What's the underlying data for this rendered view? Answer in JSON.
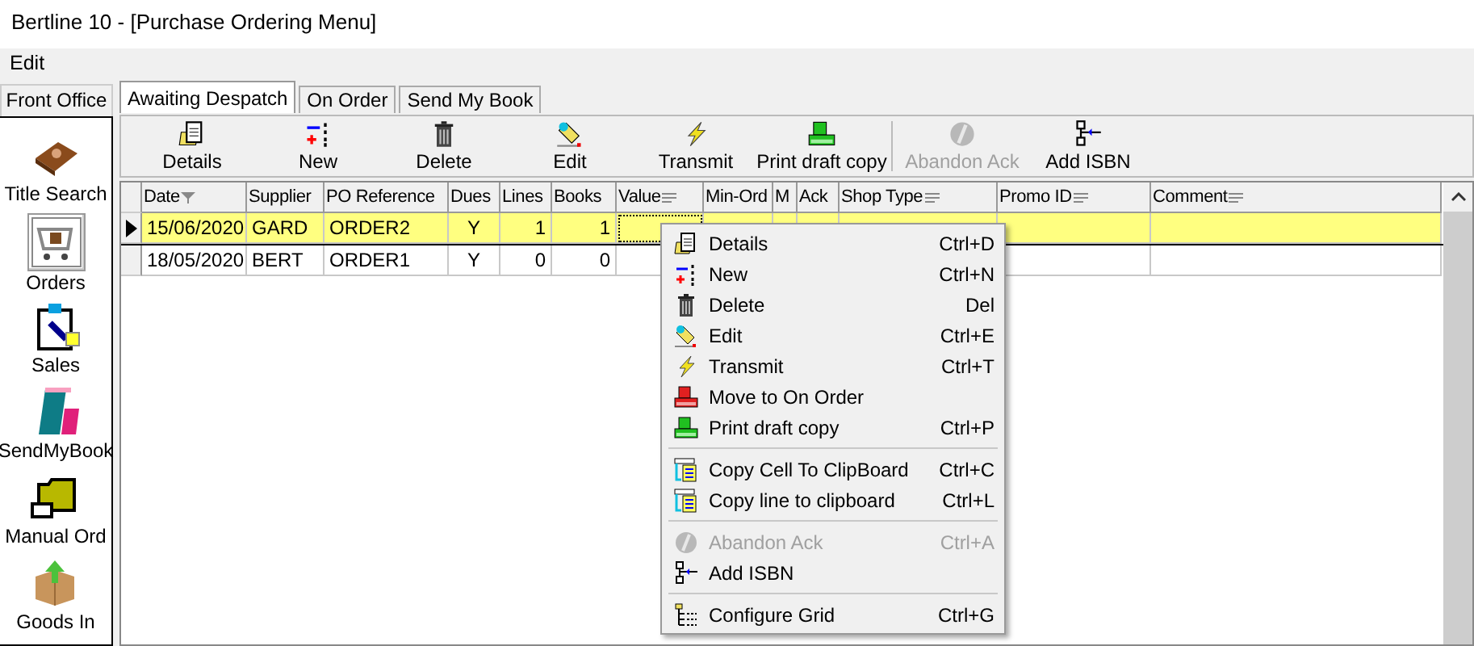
{
  "window": {
    "title": "Bertline 10 - [Purchase Ordering Menu]"
  },
  "menu_bar": [
    "Edit"
  ],
  "sidebar": {
    "tab": "Front Office",
    "items": [
      {
        "label": "Title Search",
        "selected": false
      },
      {
        "label": "Orders",
        "selected": true
      },
      {
        "label": "Sales",
        "selected": false
      },
      {
        "label": "SendMyBook",
        "selected": false
      },
      {
        "label": "Manual Ord",
        "selected": false
      },
      {
        "label": "Goods In",
        "selected": false
      }
    ]
  },
  "tabs": [
    {
      "label": "Awaiting Despatch",
      "selected": true
    },
    {
      "label": "On Order",
      "selected": false
    },
    {
      "label": "Send My Book",
      "selected": false
    }
  ],
  "toolbar": [
    {
      "label": "Details",
      "disabled": false
    },
    {
      "label": "New",
      "disabled": false
    },
    {
      "label": "Delete",
      "disabled": false
    },
    {
      "label": "Edit",
      "disabled": false
    },
    {
      "label": "Transmit",
      "disabled": false
    },
    {
      "label": "Print draft copy",
      "disabled": false
    },
    {
      "label": "Abandon Ack",
      "disabled": true
    },
    {
      "label": "Add ISBN",
      "disabled": false
    }
  ],
  "table": {
    "columns": [
      {
        "label": "Date",
        "sorted": true,
        "filter": false
      },
      {
        "label": "Supplier",
        "sorted": false,
        "filter": false
      },
      {
        "label": "PO Reference",
        "sorted": false,
        "filter": false
      },
      {
        "label": "Dues",
        "sorted": false,
        "filter": false
      },
      {
        "label": "Lines",
        "sorted": false,
        "filter": false
      },
      {
        "label": "Books",
        "sorted": false,
        "filter": false
      },
      {
        "label": "Value",
        "sorted": false,
        "filter": true
      },
      {
        "label": "Min-Ord",
        "sorted": false,
        "filter": false
      },
      {
        "label": "M",
        "sorted": false,
        "filter": false
      },
      {
        "label": "Ack",
        "sorted": false,
        "filter": false
      },
      {
        "label": "Shop Type",
        "sorted": false,
        "filter": true
      },
      {
        "label": "Promo ID",
        "sorted": false,
        "filter": true
      },
      {
        "label": "Comment",
        "sorted": false,
        "filter": true
      }
    ],
    "rows": [
      {
        "selected": true,
        "cells": [
          "15/06/2020",
          "GARD",
          "ORDER2",
          "Y",
          "1",
          "1",
          "",
          "",
          "",
          "",
          "",
          "",
          ""
        ]
      },
      {
        "selected": false,
        "cells": [
          "18/05/2020",
          "BERT",
          "ORDER1",
          "Y",
          "0",
          "0",
          "",
          "",
          "",
          "",
          "",
          "",
          ""
        ]
      }
    ]
  },
  "context_menu": [
    [
      {
        "label": "Details",
        "shortcut": "Ctrl+D",
        "disabled": false
      },
      {
        "label": "New",
        "shortcut": "Ctrl+N",
        "disabled": false
      },
      {
        "label": "Delete",
        "shortcut": "Del",
        "disabled": false
      },
      {
        "label": "Edit",
        "shortcut": "Ctrl+E",
        "disabled": false
      },
      {
        "label": "Transmit",
        "shortcut": "Ctrl+T",
        "disabled": false
      },
      {
        "label": "Move to On Order",
        "disabled": false
      },
      {
        "label": "Print draft copy",
        "shortcut": "Ctrl+P",
        "disabled": false
      }
    ],
    [
      {
        "label": "Copy Cell To ClipBoard",
        "shortcut": "Ctrl+C",
        "disabled": false
      },
      {
        "label": "Copy line to clipboard",
        "shortcut": "Ctrl+L",
        "disabled": false
      }
    ],
    [
      {
        "label": "Abandon Ack",
        "shortcut": "Ctrl+A",
        "disabled": true
      },
      {
        "label": "Add ISBN",
        "disabled": false
      }
    ],
    [
      {
        "label": "Configure Grid",
        "shortcut": "Ctrl+G",
        "disabled": false
      }
    ]
  ]
}
